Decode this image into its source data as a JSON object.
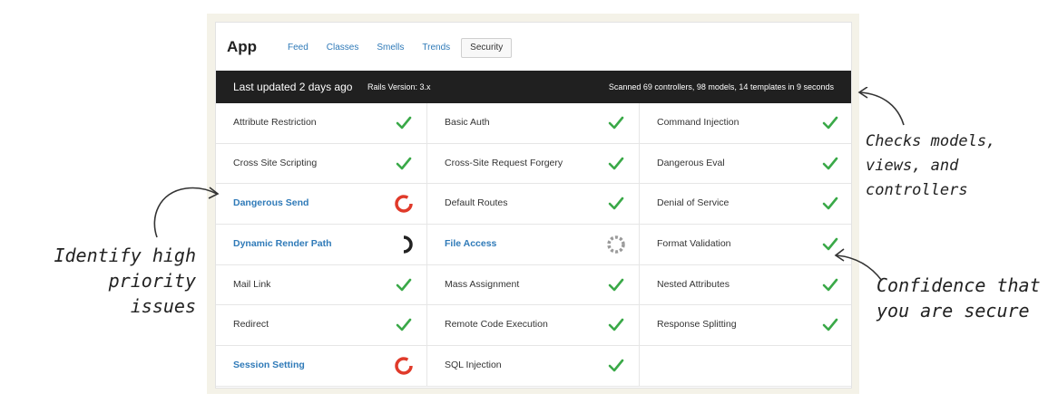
{
  "header": {
    "app_title": "App",
    "tabs": [
      {
        "label": "Feed",
        "active": false
      },
      {
        "label": "Classes",
        "active": false
      },
      {
        "label": "Smells",
        "active": false
      },
      {
        "label": "Trends",
        "active": false
      },
      {
        "label": "Security",
        "active": true
      }
    ]
  },
  "status": {
    "updated": "Last updated 2 days ago",
    "rails": "Rails Version: 3.x",
    "scanned": "Scanned 69 controllers, 98 models, 14 templates in 9 seconds"
  },
  "checks": [
    {
      "label": "Attribute Restriction",
      "status": "ok"
    },
    {
      "label": "Basic Auth",
      "status": "ok"
    },
    {
      "label": "Command Injection",
      "status": "ok"
    },
    {
      "label": "Cross Site Scripting",
      "status": "ok"
    },
    {
      "label": "Cross-Site Request Forgery",
      "status": "ok"
    },
    {
      "label": "Dangerous Eval",
      "status": "ok"
    },
    {
      "label": "Dangerous Send",
      "status": "high"
    },
    {
      "label": "Default Routes",
      "status": "ok"
    },
    {
      "label": "Denial of Service",
      "status": "ok"
    },
    {
      "label": "Dynamic Render Path",
      "status": "medium"
    },
    {
      "label": "File Access",
      "status": "low"
    },
    {
      "label": "Format Validation",
      "status": "ok"
    },
    {
      "label": "Mail Link",
      "status": "ok"
    },
    {
      "label": "Mass Assignment",
      "status": "ok"
    },
    {
      "label": "Nested Attributes",
      "status": "ok"
    },
    {
      "label": "Redirect",
      "status": "ok"
    },
    {
      "label": "Remote Code Execution",
      "status": "ok"
    },
    {
      "label": "Response Splitting",
      "status": "ok"
    },
    {
      "label": "Session Setting",
      "status": "high"
    },
    {
      "label": "SQL Injection",
      "status": "ok"
    },
    {
      "label": "",
      "status": "none"
    }
  ],
  "colors": {
    "ok": "#3aa948",
    "high": "#e03a2a",
    "medium": "#222222",
    "low": "#9a9a9a",
    "link": "#2f7ab8"
  },
  "annotations": {
    "left": [
      "Identify high",
      "priority issues"
    ],
    "right_top": [
      "Checks models,",
      "views, and controllers"
    ],
    "right_bottom": [
      "Confidence that",
      "you are secure"
    ]
  }
}
